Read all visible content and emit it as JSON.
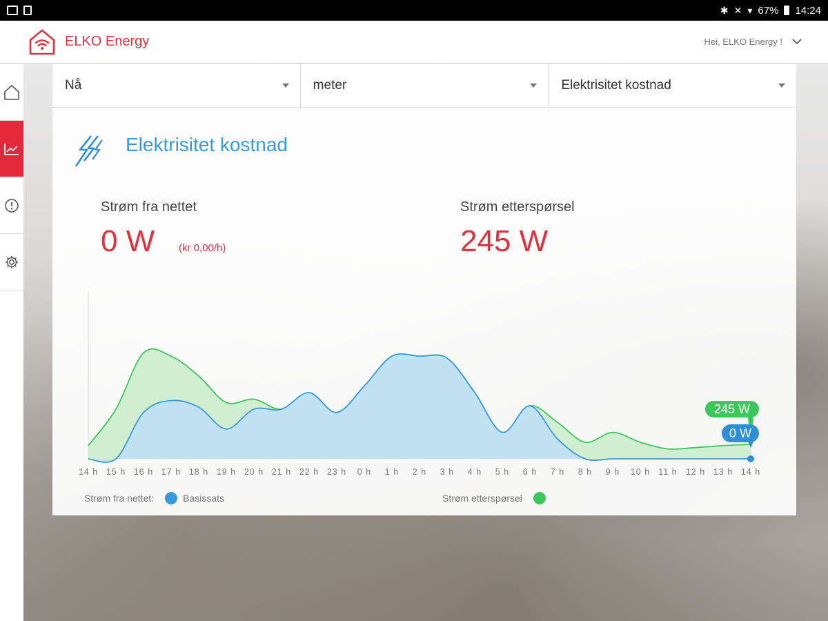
{
  "status_bar": {
    "battery": "67%",
    "time": "14:24"
  },
  "header": {
    "brand": "ELKO Energy",
    "greeting": "Hei, ELKO Energy !"
  },
  "sidebar": {
    "items": [
      {
        "icon": "home-icon"
      },
      {
        "icon": "chart-icon",
        "active": true
      },
      {
        "icon": "alert-icon"
      },
      {
        "icon": "gear-icon"
      }
    ]
  },
  "selectors": [
    {
      "value": "Nå"
    },
    {
      "value": "meter"
    },
    {
      "value": "Elektrisitet kostnad"
    }
  ],
  "card": {
    "title": "Elektrisitet kostnad",
    "grid_label": "Strøm fra nettet",
    "grid_value": "0 W",
    "grid_cost": "(kr 0,00/h)",
    "demand_label": "Strøm etterspørsel",
    "demand_value": "245 W"
  },
  "legend": {
    "grid_prefix": "Strøm fra nettet:",
    "grid_series": "Basissats",
    "demand": "Strøm etterspørsel"
  },
  "colors": {
    "accent_red": "#e0323e",
    "blue": "#3a9ad9",
    "green": "#3ec65a",
    "blue_fill": "#bfe0f3",
    "green_fill": "#cdeecf"
  },
  "chart_data": {
    "type": "area",
    "x": [
      "14 h",
      "15 h",
      "16 h",
      "17 h",
      "18 h",
      "19 h",
      "20 h",
      "21 h",
      "22 h",
      "23 h",
      "0 h",
      "1 h",
      "2 h",
      "3 h",
      "4 h",
      "5 h",
      "6 h",
      "7 h",
      "8 h",
      "9 h",
      "10 h",
      "11 h",
      "12 h",
      "13 h",
      "14 h"
    ],
    "series": [
      {
        "name": "Strøm etterspørsel",
        "color": "#3ec65a",
        "values": [
          20,
          75,
          160,
          155,
          125,
          85,
          90,
          75,
          100,
          70,
          110,
          155,
          155,
          152,
          100,
          40,
          80,
          55,
          25,
          40,
          25,
          15,
          17,
          20,
          22
        ]
      },
      {
        "name": "Basissats",
        "color": "#3a9ad9",
        "values": [
          0,
          0,
          70,
          88,
          78,
          45,
          75,
          75,
          100,
          70,
          110,
          155,
          155,
          152,
          100,
          40,
          80,
          30,
          0,
          0,
          0,
          0,
          0,
          0,
          0
        ]
      }
    ],
    "end_labels": {
      "demand": "245 W",
      "grid": "0 W"
    },
    "ylim": [
      0,
      250
    ],
    "grid": false
  }
}
